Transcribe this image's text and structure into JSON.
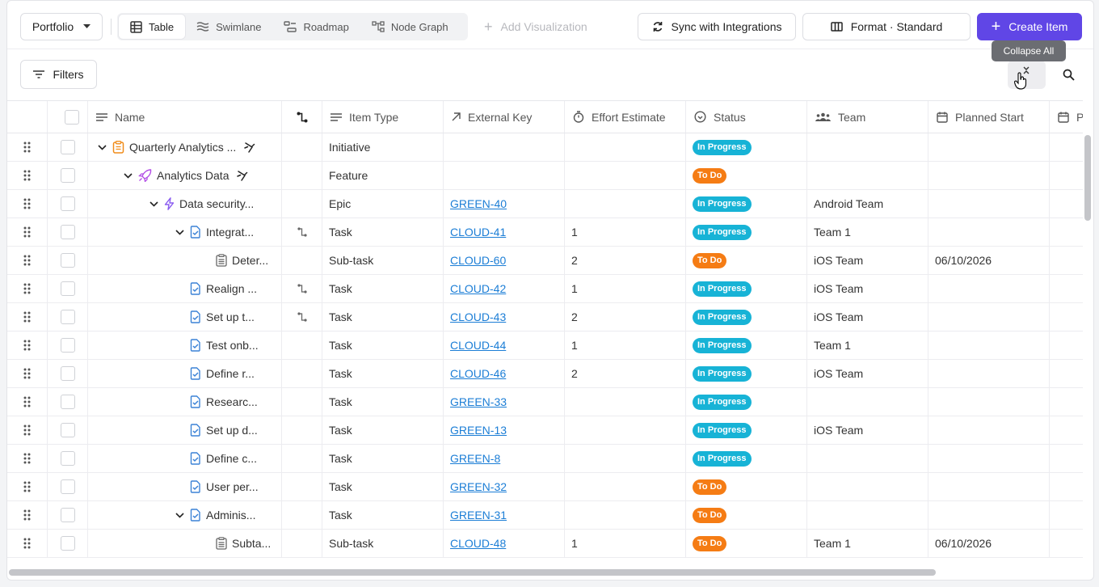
{
  "toolbar": {
    "portfolio": "Portfolio",
    "views": [
      "Table",
      "Swimlane",
      "Roadmap",
      "Node Graph"
    ],
    "add_viz": "Add Visualization",
    "sync": "Sync with Integrations",
    "format": "Format · Standard",
    "create": "Create Item"
  },
  "filters": "Filters",
  "tooltip": "Collapse All",
  "columns": {
    "name": "Name",
    "type": "Item Type",
    "key": "External Key",
    "effort": "Effort Estimate",
    "status": "Status",
    "team": "Team",
    "start": "Planned Start",
    "pla": "Pla"
  },
  "rows": [
    {
      "name": "Quarterly Analytics ...",
      "icon": "initiative",
      "indent": 0,
      "chev": true,
      "pin": true,
      "link": false,
      "type": "Initiative",
      "key": "",
      "effort": "",
      "status": "In Progress",
      "team": "",
      "start": ""
    },
    {
      "name": "Analytics Data",
      "icon": "feature",
      "indent": 1,
      "chev": true,
      "pin": true,
      "link": false,
      "type": "Feature",
      "key": "",
      "effort": "",
      "status": "To Do",
      "team": "",
      "start": ""
    },
    {
      "name": "Data security...",
      "icon": "epic",
      "indent": 2,
      "chev": true,
      "pin": false,
      "link": false,
      "type": "Epic",
      "key": "GREEN-40",
      "effort": "",
      "status": "In Progress",
      "team": "Android Team",
      "start": ""
    },
    {
      "name": "Integrat...",
      "icon": "task",
      "indent": 3,
      "chev": true,
      "pin": false,
      "link": true,
      "type": "Task",
      "key": "CLOUD-41",
      "effort": "1",
      "status": "In Progress",
      "team": "Team 1",
      "start": ""
    },
    {
      "name": "Deter...",
      "icon": "subtask",
      "indent": 4,
      "chev": false,
      "pin": false,
      "link": false,
      "type": "Sub-task",
      "key": "CLOUD-60",
      "effort": "2",
      "status": "To Do",
      "team": "iOS Team",
      "start": "06/10/2026"
    },
    {
      "name": "Realign ...",
      "icon": "task",
      "indent": 3,
      "chev": false,
      "pin": false,
      "link": true,
      "type": "Task",
      "key": "CLOUD-42",
      "effort": "1",
      "status": "In Progress",
      "team": "iOS Team",
      "start": ""
    },
    {
      "name": "Set up t...",
      "icon": "task",
      "indent": 3,
      "chev": false,
      "pin": false,
      "link": true,
      "type": "Task",
      "key": "CLOUD-43",
      "effort": "2",
      "status": "In Progress",
      "team": "iOS Team",
      "start": ""
    },
    {
      "name": "Test onb...",
      "icon": "task",
      "indent": 3,
      "chev": false,
      "pin": false,
      "link": false,
      "type": "Task",
      "key": "CLOUD-44",
      "effort": "1",
      "status": "In Progress",
      "team": "Team 1",
      "start": ""
    },
    {
      "name": "Define r...",
      "icon": "task",
      "indent": 3,
      "chev": false,
      "pin": false,
      "link": false,
      "type": "Task",
      "key": "CLOUD-46",
      "effort": "2",
      "status": "In Progress",
      "team": "iOS Team",
      "start": ""
    },
    {
      "name": "Researc...",
      "icon": "task",
      "indent": 3,
      "chev": false,
      "pin": false,
      "link": false,
      "type": "Task",
      "key": "GREEN-33",
      "effort": "",
      "status": "In Progress",
      "team": "",
      "start": ""
    },
    {
      "name": "Set up d...",
      "icon": "task",
      "indent": 3,
      "chev": false,
      "pin": false,
      "link": false,
      "type": "Task",
      "key": "GREEN-13",
      "effort": "",
      "status": "In Progress",
      "team": "iOS Team",
      "start": ""
    },
    {
      "name": "Define c...",
      "icon": "task",
      "indent": 3,
      "chev": false,
      "pin": false,
      "link": false,
      "type": "Task",
      "key": "GREEN-8",
      "effort": "",
      "status": "In Progress",
      "team": "",
      "start": ""
    },
    {
      "name": "User per...",
      "icon": "task",
      "indent": 3,
      "chev": false,
      "pin": false,
      "link": false,
      "type": "Task",
      "key": "GREEN-32",
      "effort": "",
      "status": "To Do",
      "team": "",
      "start": ""
    },
    {
      "name": "Adminis...",
      "icon": "task",
      "indent": 3,
      "chev": true,
      "pin": false,
      "link": false,
      "type": "Task",
      "key": "GREEN-31",
      "effort": "",
      "status": "To Do",
      "team": "",
      "start": ""
    },
    {
      "name": "Subta...",
      "icon": "subtask",
      "indent": 4,
      "chev": false,
      "pin": false,
      "link": false,
      "type": "Sub-task",
      "key": "CLOUD-48",
      "effort": "1",
      "status": "To Do",
      "team": "Team 1",
      "start": "06/10/2026"
    }
  ],
  "colors": {
    "accent": "#6046e6",
    "in_progress": "#17b3d6",
    "to_do": "#f57c14",
    "link": "#1c7ed6"
  }
}
